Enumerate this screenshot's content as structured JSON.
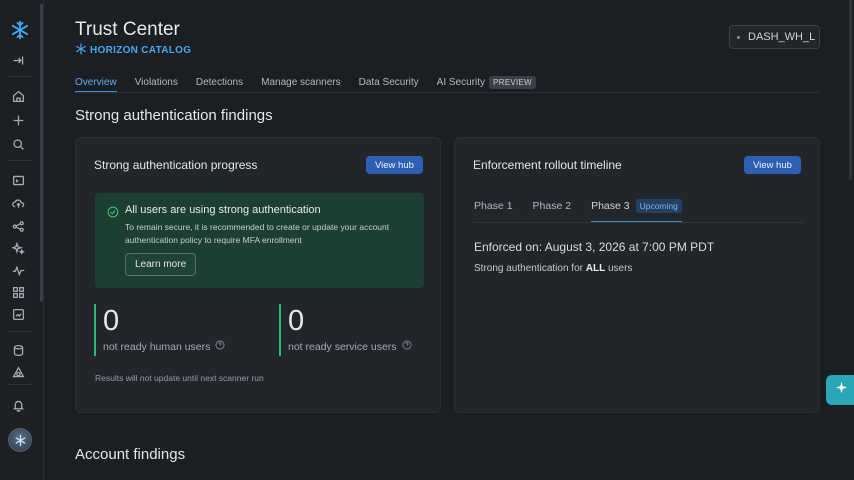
{
  "header": {
    "title": "Trust Center",
    "subtitle": "HORIZON CATALOG",
    "warehouse": "DASH_WH_L"
  },
  "tabs": [
    {
      "label": "Overview"
    },
    {
      "label": "Violations"
    },
    {
      "label": "Detections"
    },
    {
      "label": "Manage scanners"
    },
    {
      "label": "Data Security"
    },
    {
      "label": "AI Security",
      "badge": "PREVIEW"
    }
  ],
  "sections": {
    "strong_auth": "Strong authentication findings",
    "account": "Account findings"
  },
  "progress_card": {
    "title": "Strong authentication progress",
    "button": "View hub",
    "success": {
      "heading": "All users are using strong authentication",
      "body": "To remain secure, it is recommended to create or update your account authentication policy to require MFA enrollment",
      "button": "Learn more"
    },
    "stats": [
      {
        "value": "0",
        "label": "not ready human users"
      },
      {
        "value": "0",
        "label": "not ready service users"
      }
    ],
    "note": "Results will not update until next scanner run"
  },
  "timeline_card": {
    "title": "Enforcement rollout timeline",
    "button": "View hub",
    "phases": [
      {
        "label": "Phase 1"
      },
      {
        "label": "Phase 2"
      },
      {
        "label": "Phase 3",
        "badge": "Upcoming"
      }
    ],
    "enforced": "Enforced on: August 3, 2026 at 7:00 PM PDT",
    "scope_prefix": "Strong authentication for ",
    "scope_bold": "ALL",
    "scope_suffix": " users"
  },
  "colors": {
    "accent": "#3d8fde",
    "success_bg": "#1c3f32",
    "success_bar": "#2eb87a",
    "button": "#2f5fb3",
    "fab": "#2aa6b8"
  },
  "icons": [
    "snowflake-logo-icon",
    "collapse-icon",
    "home-icon",
    "plus-icon",
    "search-icon",
    "terminal-icon",
    "cloud-upload-icon",
    "share-nodes-icon",
    "sparkle-icon",
    "activity-icon",
    "grid-icon",
    "monitor-icon",
    "database-icon",
    "shapes-icon",
    "bell-icon",
    "check-circle-icon",
    "help-circle-icon",
    "assistant-sparkle-icon"
  ]
}
